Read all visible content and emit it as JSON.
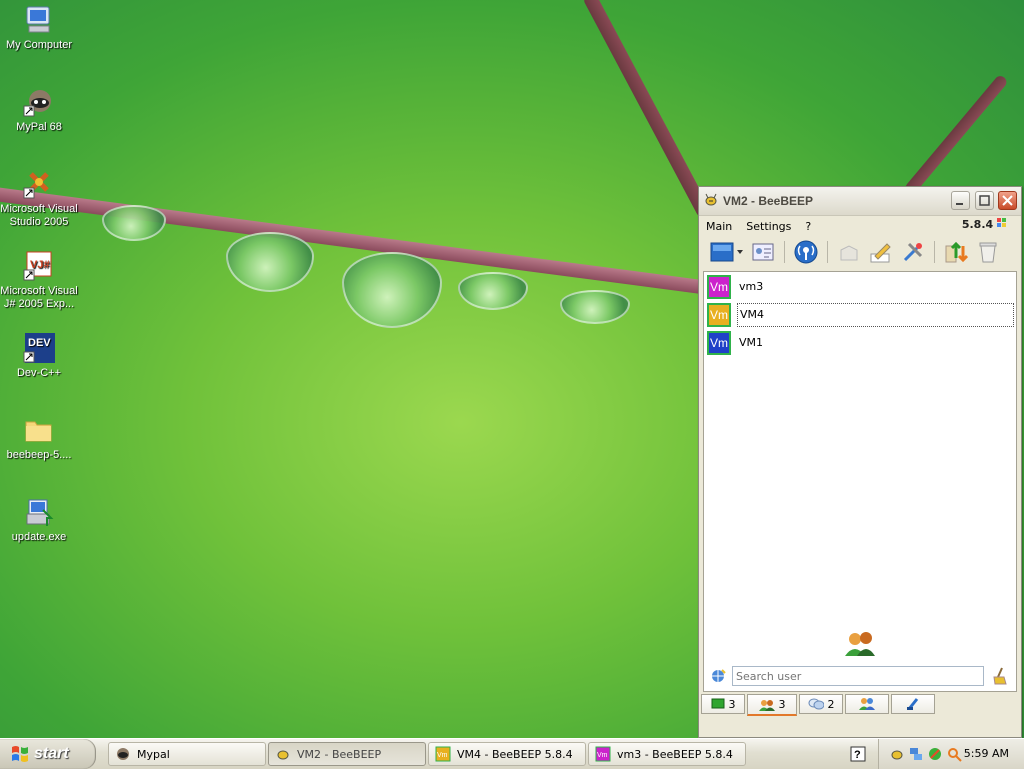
{
  "desktop": {
    "icons": [
      {
        "label": "My Computer"
      },
      {
        "label": "MyPal 68"
      },
      {
        "label": "Microsoft Visual Studio 2005"
      },
      {
        "label": "Microsoft Visual J# 2005 Exp..."
      },
      {
        "label": "Dev-C++"
      },
      {
        "label": "beebeep-5...."
      },
      {
        "label": "update.exe"
      }
    ]
  },
  "window": {
    "title": "VM2 - BeeBEEP",
    "version": "5.8.4",
    "menu": [
      "Main",
      "Settings",
      "?"
    ],
    "users": [
      {
        "avatar": "Vm",
        "name": "vm3",
        "color": "#cc22cc"
      },
      {
        "avatar": "Vm",
        "name": "VM4",
        "color": "#e8b020"
      },
      {
        "avatar": "Vm",
        "name": "VM1",
        "color": "#2040c8"
      }
    ],
    "search_placeholder": "Search user",
    "tabs": [
      {
        "icon": "chat-icon",
        "count": "3"
      },
      {
        "icon": "users-icon",
        "count": "3"
      },
      {
        "icon": "messages-icon",
        "count": "2"
      },
      {
        "icon": "groups-icon",
        "count": ""
      },
      {
        "icon": "files-icon",
        "count": ""
      }
    ]
  },
  "taskbar": {
    "start_label": "start",
    "tasks": [
      {
        "label": "Mypal"
      },
      {
        "label": "VM2 - BeeBEEP"
      },
      {
        "label": "VM4 - BeeBEEP 5.8.4"
      },
      {
        "label": "vm3 - BeeBEEP 5.8.4"
      }
    ],
    "clock": "5:59 AM"
  }
}
